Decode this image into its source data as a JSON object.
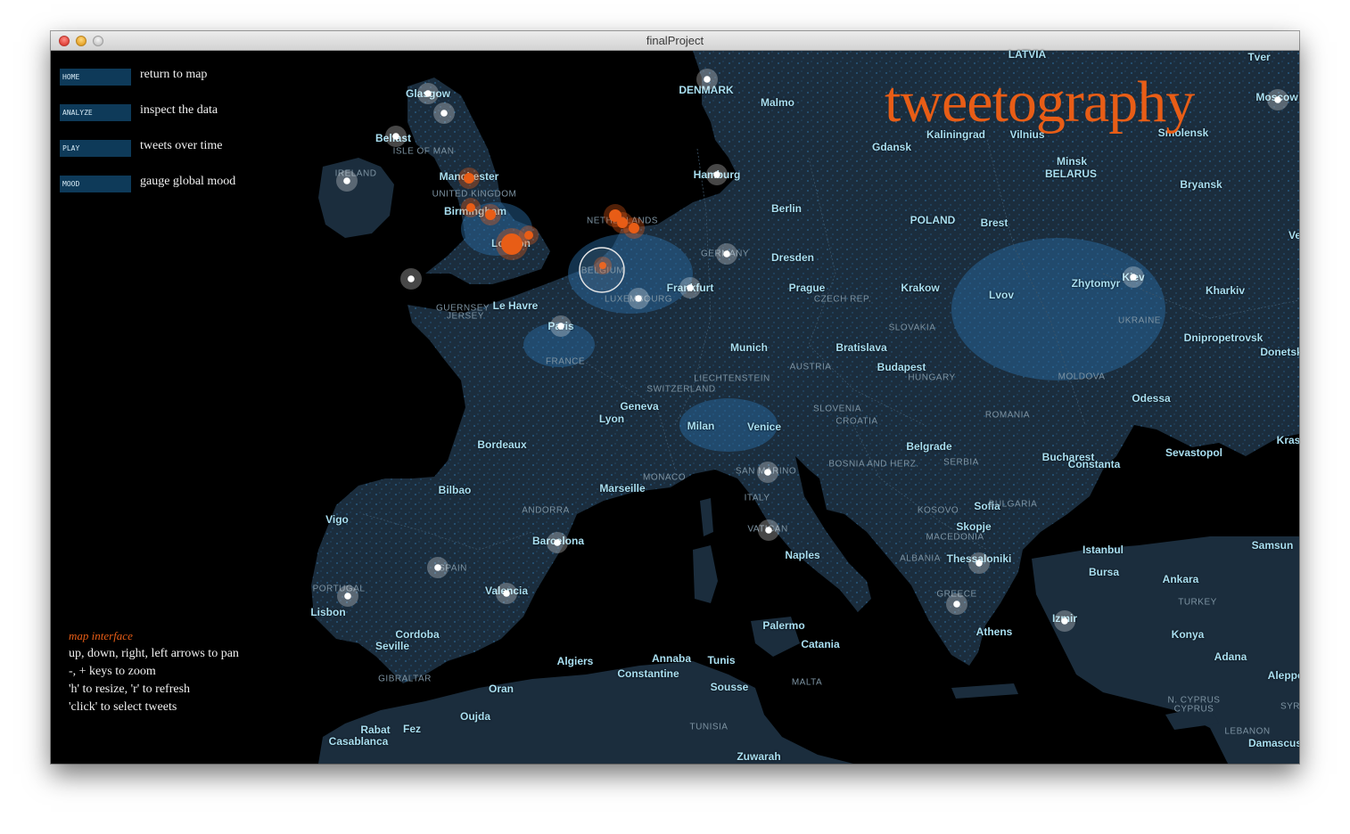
{
  "window": {
    "title": "finalProject"
  },
  "app_title": "tweetography",
  "menu": [
    {
      "label": "HOME",
      "desc": "return to map"
    },
    {
      "label": "ANALYZE",
      "desc": "inspect the data"
    },
    {
      "label": "PLAY",
      "desc": "tweets over time"
    },
    {
      "label": "MOOD",
      "desc": "gauge global mood"
    }
  ],
  "help": {
    "title": "map interface",
    "lines": [
      "up, down, right, left arrows to pan",
      "-, + keys to zoom",
      "'h' to resize, 'r' to refresh",
      "'click' to select tweets"
    ]
  },
  "colors": {
    "accent": "#e85d16",
    "land": "#1b2d3d",
    "sea": "#000000",
    "city_label": "#a9dff1",
    "country_label": "#7d93a2",
    "button_bg": "#0e3a59",
    "tweet_neutral": "#ffffff",
    "tweet_orange": "#e85d16"
  },
  "map": {
    "cities": [
      "Glasgow",
      "DENMARK",
      "Malmo",
      "LATVIA",
      "Tver",
      "Moscow",
      "Belfast",
      "Kaliningrad",
      "Vilnius",
      "Smolensk",
      "Gdansk",
      "Minsk",
      "BELARUS",
      "Bryansk",
      "Manchester",
      "Hamburg",
      "Berlin",
      "Birmingham",
      "POLAND",
      "Brest",
      "London",
      "Dresden",
      "Prague",
      "Krakow",
      "Zhytomyr",
      "Kiev",
      "Kharkiv",
      "Frankfurt",
      "Lvov",
      "Le Havre",
      "Paris",
      "Munich",
      "Bratislava",
      "Dnipropetrovsk",
      "Donetsk",
      "Budapest",
      "Geneva",
      "Lyon",
      "Milan",
      "Venice",
      "Odessa",
      "Bordeaux",
      "Belgrade",
      "Bucharest",
      "Constanta",
      "Sevastopol",
      "Marseille",
      "Bilbao",
      "Vigo",
      "Barcelona",
      "Sofia",
      "Skopje",
      "Istanbul",
      "Samsun",
      "Naples",
      "Valencia",
      "Thessaloniki",
      "Bursa",
      "Ankara",
      "Lisbon",
      "Cordoba",
      "Seville",
      "Palermo",
      "Athens",
      "Izmir",
      "Konya",
      "Adana",
      "Aleppo",
      "Algiers",
      "Annaba",
      "Tunis",
      "Constantine",
      "Oran",
      "Sousse",
      "Catania",
      "Oujda",
      "Rabat",
      "Fez",
      "Casablanca",
      "Zuwarah",
      "Damascus",
      "Kras",
      "Ve"
    ],
    "countries": [
      "ISLE OF MAN",
      "IRELAND",
      "UNITED KINGDOM",
      "NETHERLANDS",
      "BELGIUM",
      "GERMANY",
      "LUXEMBOURG",
      "GUERNSEY",
      "JERSEY",
      "FRANCE",
      "CZECH REP.",
      "SLOVAKIA",
      "AUSTRIA",
      "LIECHTENSTEIN",
      "SWITZERLAND",
      "HUNGARY",
      "MOLDOVA",
      "UKRAINE",
      "SLOVENIA",
      "CROATIA",
      "ROMANIA",
      "BOSNIA AND HERZ.",
      "SERBIA",
      "MONACO",
      "SAN MARINO",
      "ANDORRA",
      "ITALY",
      "VATICAN",
      "KOSOVO",
      "BULGARIA",
      "MACEDONIA",
      "ALBANIA",
      "SPAIN",
      "PORTUGAL",
      "GREECE",
      "TURKEY",
      "GIBRALTAR",
      "MALTA",
      "TUNISIA",
      "N. CYPRUS",
      "CYPRUS",
      "LEBANON",
      "SYR"
    ]
  }
}
